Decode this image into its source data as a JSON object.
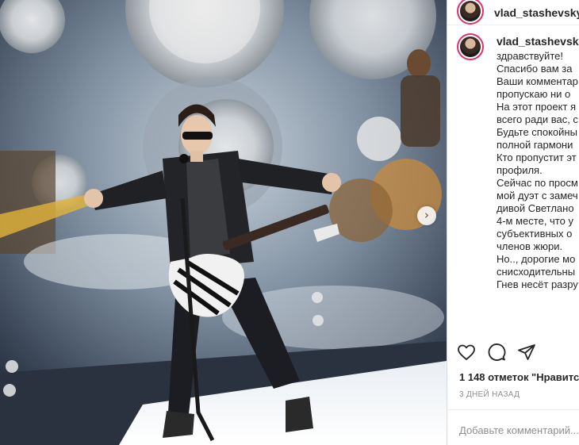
{
  "post": {
    "username": "vlad_stashevsky",
    "caption_user": "vlad_stashevsky",
    "caption_lines": [
      "здравствуйте!",
      "Спасибо вам за",
      "Ваши комментар",
      "пропускаю ни о",
      "На этот проект я",
      "всего ради вас, с",
      "Будьте спокойны",
      "полной гармони",
      "Кто пропустит эт",
      "профиля.",
      "Сейчас по просм",
      "мой дуэт с замеч",
      "дивой Светлано",
      "4-м месте, что у",
      "субъективных о",
      "членов жюри.",
      "Но.., дорогие мо",
      "снисходительны",
      "Гнев несёт разру"
    ],
    "likes": "1 148 отметок \"Нравитс",
    "timestamp": "3 ДНЕЙ НАЗАД",
    "comment_placeholder": "Добавьте комментарий..."
  },
  "icons": {
    "like": "heart-icon",
    "comment": "comment-icon",
    "share": "send-icon",
    "next": "chevron-right-icon"
  },
  "colors": {
    "avatar_ring": "#e1306c",
    "text": "#262626",
    "muted": "#8e8e8e",
    "divider": "#efefef"
  }
}
